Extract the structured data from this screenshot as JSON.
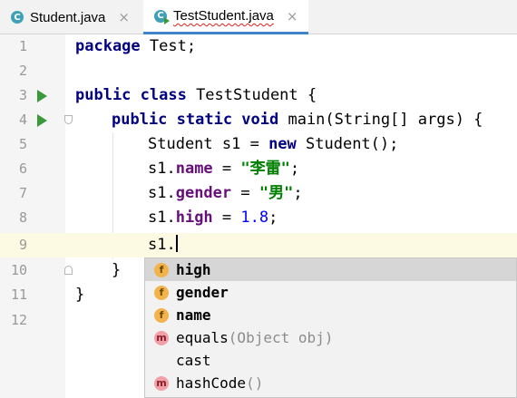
{
  "tabs": [
    {
      "label": "Student.java",
      "close": "×"
    },
    {
      "label": "TestStudent.java",
      "close": "×"
    }
  ],
  "line_numbers": [
    "1",
    "2",
    "3",
    "4",
    "5",
    "6",
    "7",
    "8",
    "9",
    "10",
    "11",
    "12"
  ],
  "code": {
    "l1_kw": "package",
    "l1_rest": " Test;",
    "l3_kw": "public class",
    "l3_rest": " TestStudent {",
    "l4_kw": "public static void",
    "l4_rest": " main(String[] args) {",
    "l5_a": "Student s1 = ",
    "l5_kw": "new",
    "l5_b": " Student();",
    "l6_a": "s1.",
    "l6_field": "name",
    "l6_b": " = ",
    "l6_str": "\"李雷\"",
    "l6_c": ";",
    "l7_a": "s1.",
    "l7_field": "gender",
    "l7_b": " = ",
    "l7_str": "\"男\"",
    "l7_c": ";",
    "l8_a": "s1.",
    "l8_field": "high",
    "l8_b": " = ",
    "l8_num": "1.8",
    "l8_c": ";",
    "l9_a": "s1.",
    "l10": "}",
    "l11": "}"
  },
  "completion": [
    {
      "icon": "f",
      "name": "high",
      "sig": ""
    },
    {
      "icon": "f",
      "name": "gender",
      "sig": ""
    },
    {
      "icon": "f",
      "name": "name",
      "sig": ""
    },
    {
      "icon": "m",
      "name": "equals",
      "sig": "(Object obj)"
    },
    {
      "icon": "",
      "name": "cast",
      "sig": ""
    },
    {
      "icon": "m",
      "name": "hashCode",
      "sig": "()"
    }
  ]
}
